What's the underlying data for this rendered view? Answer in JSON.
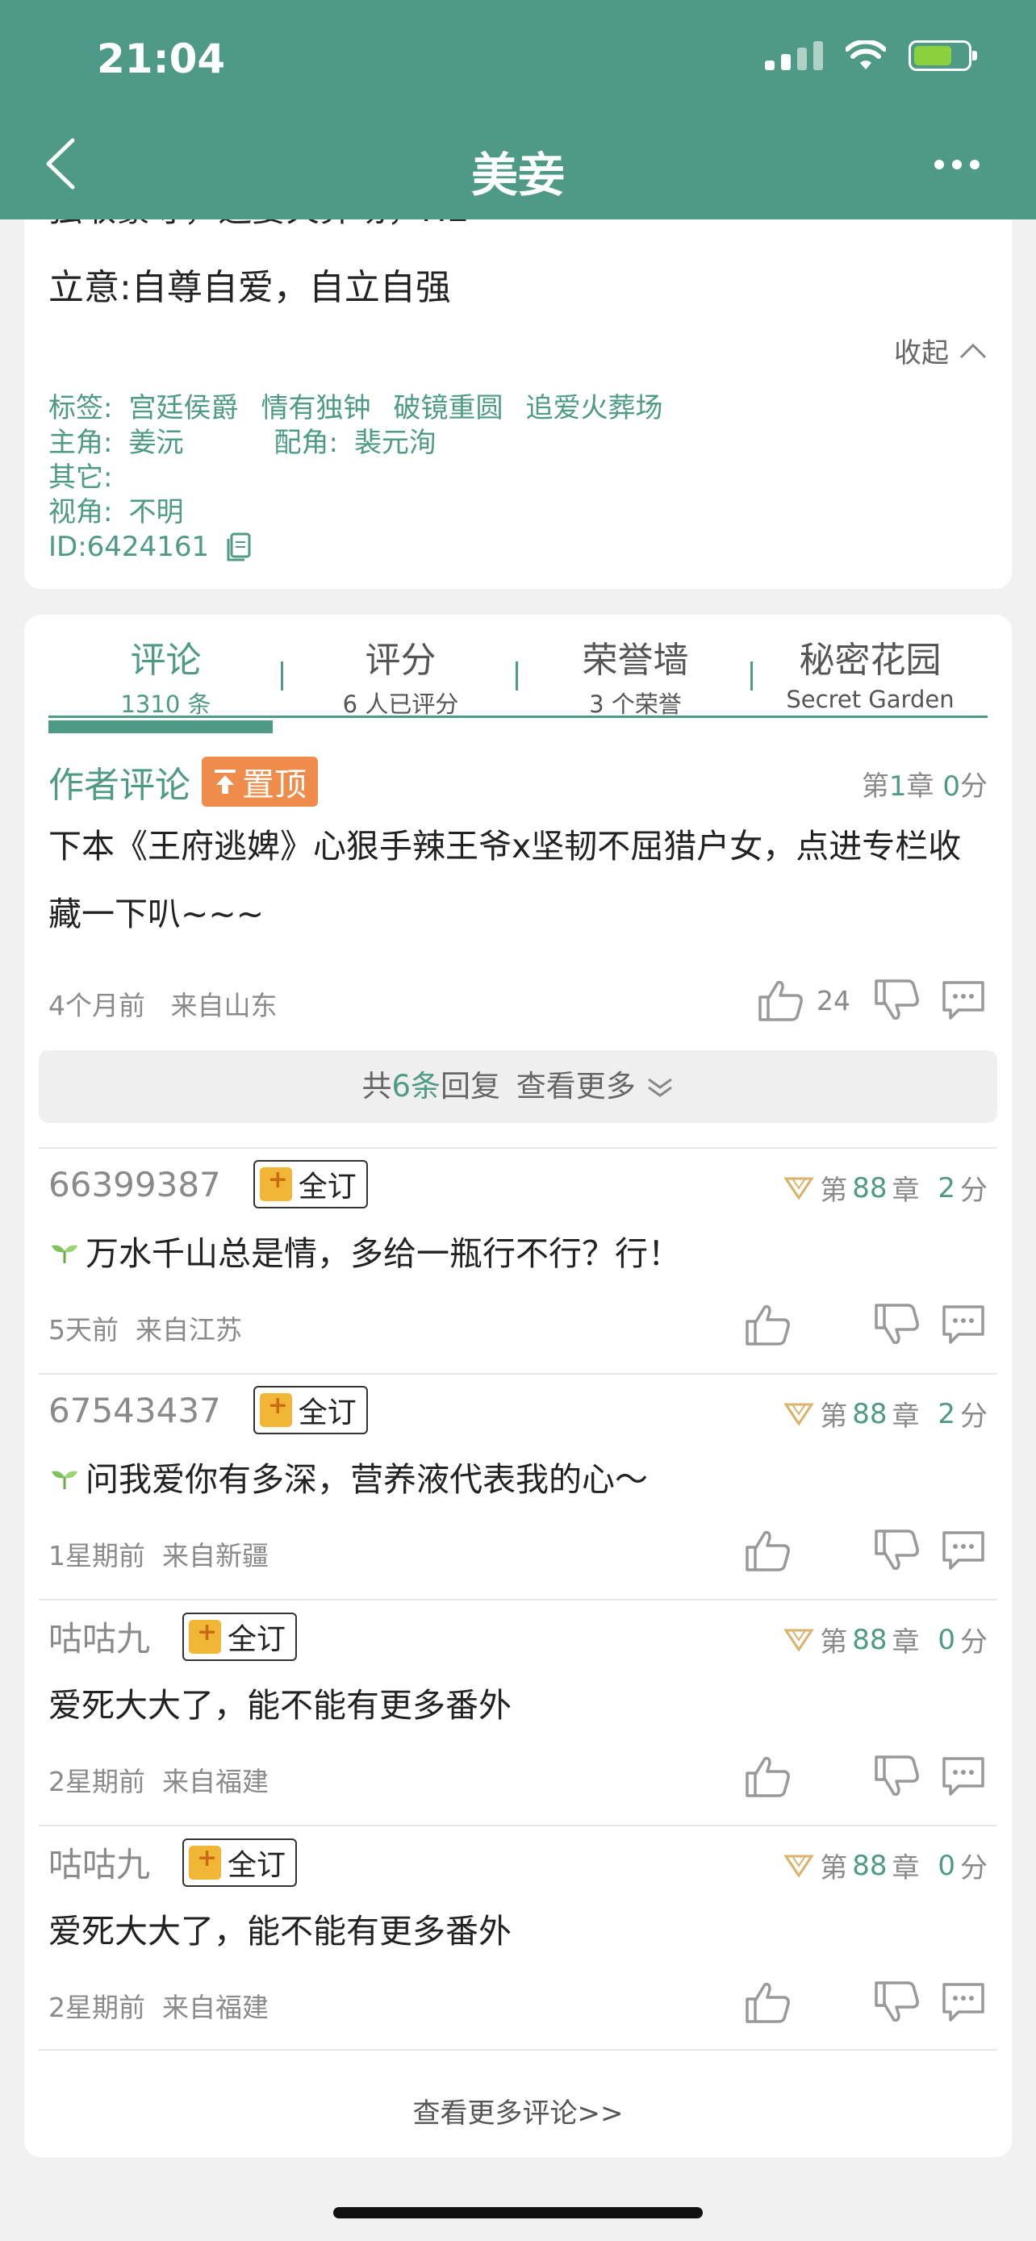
{
  "status": {
    "time": "21:04"
  },
  "header": {
    "title": "美妾"
  },
  "book": {
    "cut_line": "独取豪夺，追妻火葬场，HE",
    "intent": "立意:自尊自爱，自立自强",
    "collapse_label": "收起",
    "tags_label": "标签:",
    "tags": [
      "宫廷侯爵",
      "情有独钟",
      "破镜重圆",
      "追爱火葬场"
    ],
    "lead_label": "主角:",
    "lead": "姜沅",
    "support_label": "配角:",
    "support": "裴元洵",
    "other_label": "其它:",
    "pov_label": "视角:",
    "pov": "不明",
    "id": "ID:6424161"
  },
  "tabs": [
    {
      "title": "评论",
      "sub": "1310 条"
    },
    {
      "title": "评分",
      "sub": "6 人已评分"
    },
    {
      "title": "荣誉墙",
      "sub": "3 个荣誉"
    },
    {
      "title": "秘密花园",
      "sub": "Secret Garden"
    }
  ],
  "author_comment": {
    "label": "作者评论",
    "pin_label": "置顶",
    "chapter_prefix": "第",
    "chapter": "1",
    "chapter_mid": "章",
    "score": "0",
    "score_suffix": "分",
    "body": "下本《王府逃婢》心狠手辣王爷x坚韧不屈猎户女，点进专栏收藏一下叭~~~",
    "time": "4个月前",
    "location": "来自山东",
    "likes": "24"
  },
  "replies": {
    "prefix": "共",
    "count": "6",
    "unit": "条",
    "suffix": "回复",
    "more": "查看更多"
  },
  "comments": [
    {
      "user": "66399387",
      "badge": "全订",
      "chapter": "88",
      "score": "2",
      "body": "万水千山总是情，多给一瓶行不行？行！",
      "sprout": true,
      "time": "5天前",
      "location": "来自江苏"
    },
    {
      "user": "67543437",
      "badge": "全订",
      "chapter": "88",
      "score": "2",
      "body": "问我爱你有多深，营养液代表我的心～",
      "sprout": true,
      "time": "1星期前",
      "location": "来自新疆"
    },
    {
      "user": "咕咕九",
      "badge": "全订",
      "chapter": "88",
      "score": "0",
      "body": "爱死大大了，能不能有更多番外",
      "sprout": false,
      "time": "2星期前",
      "location": "来自福建"
    },
    {
      "user": "咕咕九",
      "badge": "全订",
      "chapter": "88",
      "score": "0",
      "body": "爱死大大了，能不能有更多番外",
      "sprout": false,
      "time": "2星期前",
      "location": "来自福建"
    }
  ],
  "chapter_word": {
    "prefix": "第",
    "mid": "章",
    "suffix": "分"
  },
  "more_comments": "查看更多评论>>",
  "colors": {
    "header": "#4f9a86",
    "accent": "#4f9a86",
    "pin": "#ef8c4c",
    "badge": "#f2b637"
  }
}
